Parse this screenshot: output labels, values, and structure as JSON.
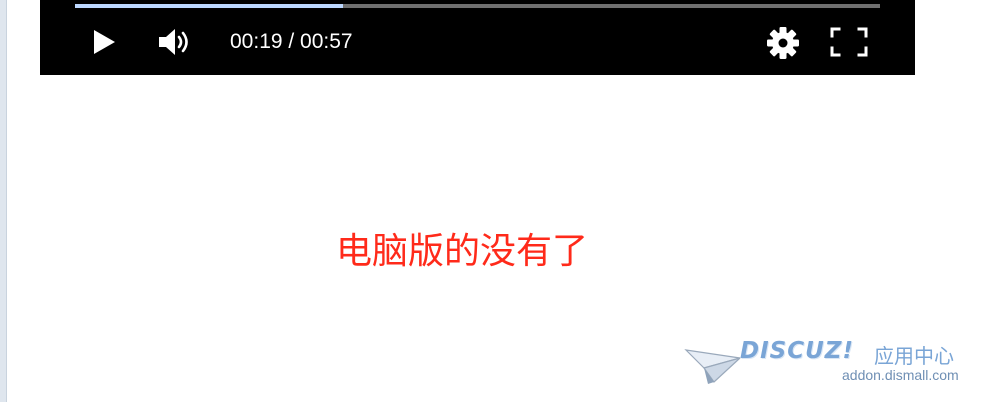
{
  "player": {
    "progress_fraction": 0.333,
    "current_time": "00:19",
    "duration": "00:57",
    "time_display": "00:19 / 00:57",
    "icons": {
      "play": "play-icon",
      "volume": "volume-icon",
      "settings": "gear-icon",
      "fullscreen": "fullscreen-icon"
    },
    "colors": {
      "background": "#000000",
      "progress_fill": "#bcd7ff",
      "progress_track": "#6f6f6f",
      "icon": "#ffffff"
    }
  },
  "content": {
    "notice_text": "电脑版的没有了",
    "notice_color": "#ff2a1a"
  },
  "watermark": {
    "brand": "DISCUZ!",
    "label": "应用中心",
    "url": "addon.dismall.com"
  }
}
